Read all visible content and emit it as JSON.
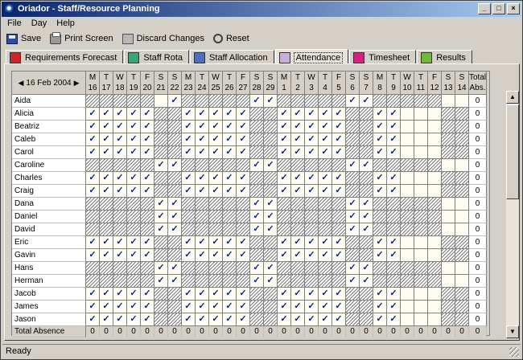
{
  "window": {
    "title": "Oriador - Staff/Resource Planning",
    "minimize": "_",
    "maximize": "□",
    "close": "×"
  },
  "menu": {
    "items": [
      "File",
      "Day",
      "Help"
    ]
  },
  "toolbar": {
    "save_label": "Save",
    "print_label": "Print Screen",
    "discard_label": "Discard Changes",
    "reset_label": "Reset"
  },
  "tabs": [
    {
      "label": "Requirements Forecast",
      "icon": "requirements-forecast-icon",
      "active": false
    },
    {
      "label": "Staff Rota",
      "icon": "staff-rota-icon",
      "active": false
    },
    {
      "label": "Staff Allocation",
      "icon": "staff-allocation-icon",
      "active": false
    },
    {
      "label": "Attendance",
      "icon": "attendance-icon",
      "active": true
    },
    {
      "label": "Timesheet",
      "icon": "timesheet-icon",
      "active": false
    },
    {
      "label": "Results",
      "icon": "results-icon",
      "active": false
    }
  ],
  "grid": {
    "date_label": "16 Feb 2004",
    "prev_arrow": "◀",
    "next_arrow": "▶",
    "check_mark": "✓",
    "total_header": [
      "Total",
      "Abs."
    ],
    "days": [
      {
        "dow": "M",
        "day": "16"
      },
      {
        "dow": "T",
        "day": "17"
      },
      {
        "dow": "W",
        "day": "18"
      },
      {
        "dow": "T",
        "day": "19"
      },
      {
        "dow": "F",
        "day": "20"
      },
      {
        "dow": "S",
        "day": "21"
      },
      {
        "dow": "S",
        "day": "22"
      },
      {
        "dow": "M",
        "day": "23"
      },
      {
        "dow": "T",
        "day": "24"
      },
      {
        "dow": "W",
        "day": "25"
      },
      {
        "dow": "T",
        "day": "26"
      },
      {
        "dow": "F",
        "day": "27"
      },
      {
        "dow": "S",
        "day": "28"
      },
      {
        "dow": "S",
        "day": "29"
      },
      {
        "dow": "M",
        "day": "1"
      },
      {
        "dow": "T",
        "day": "2"
      },
      {
        "dow": "W",
        "day": "3"
      },
      {
        "dow": "T",
        "day": "4"
      },
      {
        "dow": "F",
        "day": "5"
      },
      {
        "dow": "S",
        "day": "6"
      },
      {
        "dow": "S",
        "day": "7"
      },
      {
        "dow": "M",
        "day": "8"
      },
      {
        "dow": "T",
        "day": "9"
      },
      {
        "dow": "W",
        "day": "10"
      },
      {
        "dow": "T",
        "day": "11"
      },
      {
        "dow": "F",
        "day": "12"
      },
      {
        "dow": "S",
        "day": "13"
      },
      {
        "dow": "S",
        "day": "14"
      }
    ],
    "rows": [
      {
        "name": "Aida",
        "pattern": "weekend2",
        "total": "0"
      },
      {
        "name": "Alicia",
        "pattern": "weekday",
        "total": "0"
      },
      {
        "name": "Beatriz",
        "pattern": "weekday",
        "total": "0"
      },
      {
        "name": "Caleb",
        "pattern": "weekday",
        "total": "0"
      },
      {
        "name": "Carol",
        "pattern": "weekday",
        "total": "0"
      },
      {
        "name": "Caroline",
        "pattern": "weekend",
        "total": "0"
      },
      {
        "name": "Charles",
        "pattern": "weekday",
        "total": "0"
      },
      {
        "name": "Craig",
        "pattern": "weekday",
        "total": "0"
      },
      {
        "name": "Dana",
        "pattern": "weekend",
        "total": "0"
      },
      {
        "name": "Daniel",
        "pattern": "weekend",
        "total": "0"
      },
      {
        "name": "David",
        "pattern": "weekend",
        "total": "0"
      },
      {
        "name": "Eric",
        "pattern": "weekday",
        "total": "0"
      },
      {
        "name": "Gavin",
        "pattern": "weekday",
        "total": "0"
      },
      {
        "name": "Hans",
        "pattern": "weekend2",
        "total": "0"
      },
      {
        "name": "Herman",
        "pattern": "weekend2",
        "total": "0"
      },
      {
        "name": "Jacob",
        "pattern": "weekday",
        "total": "0"
      },
      {
        "name": "James",
        "pattern": "weekday",
        "total": "0"
      },
      {
        "name": "Jason",
        "pattern": "weekday",
        "total": "0"
      }
    ],
    "footer": {
      "label": "Total Absence",
      "values": [
        "0",
        "0",
        "0",
        "0",
        "0",
        "0",
        "0",
        "0",
        "0",
        "0",
        "0",
        "0",
        "0",
        "0",
        "0",
        "0",
        "0",
        "0",
        "0",
        "0",
        "0",
        "0",
        "0",
        "0",
        "0",
        "0",
        "0",
        "0"
      ],
      "total": "0"
    }
  },
  "scrollbar": {
    "up": "▲",
    "down": "▼"
  },
  "status": {
    "text": "Ready"
  },
  "colors": {
    "check": "#0a1e8c",
    "title_start": "#0a246a",
    "title_end": "#a6caf0"
  }
}
